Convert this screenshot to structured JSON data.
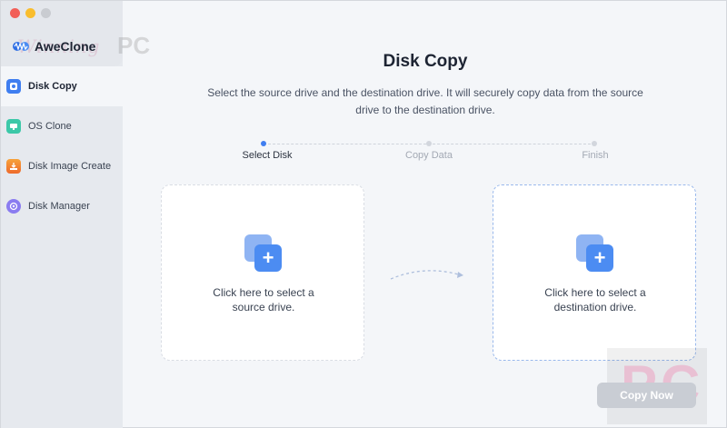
{
  "window": {
    "traffic_lights": [
      "close",
      "minimize",
      "zoom"
    ]
  },
  "app": {
    "name": "AweClone",
    "watermark_text": "Winning",
    "watermark_pc": "PC"
  },
  "sidebar": {
    "items": [
      {
        "label": "Disk Copy",
        "icon": "disk-copy-icon",
        "active": true
      },
      {
        "label": "OS Clone",
        "icon": "os-clone-icon",
        "active": false
      },
      {
        "label": "Disk Image Create",
        "icon": "disk-image-icon",
        "active": false
      },
      {
        "label": "Disk Manager",
        "icon": "disk-manager-icon",
        "active": false
      }
    ]
  },
  "main": {
    "title": "Disk Copy",
    "subtitle": "Select the source drive and the destination drive. It will securely copy data from the source drive to the destination drive.",
    "steps": [
      {
        "label": "Select Disk",
        "active": true
      },
      {
        "label": "Copy Data",
        "active": false
      },
      {
        "label": "Finish",
        "active": false
      }
    ],
    "source": {
      "text_line1": "Click here to select a",
      "text_line2": "source drive."
    },
    "destination": {
      "text_line1": "Click here to select a",
      "text_line2": "destination drive."
    },
    "copy_button": "Copy Now",
    "corner_watermark": "PC"
  },
  "colors": {
    "accent": "#4c8cf2",
    "accent_light": "#8fb4f3",
    "sidebar_bg": "#e6e9ee",
    "content_bg": "#f4f6f9",
    "button_disabled": "#c9cdd4"
  }
}
